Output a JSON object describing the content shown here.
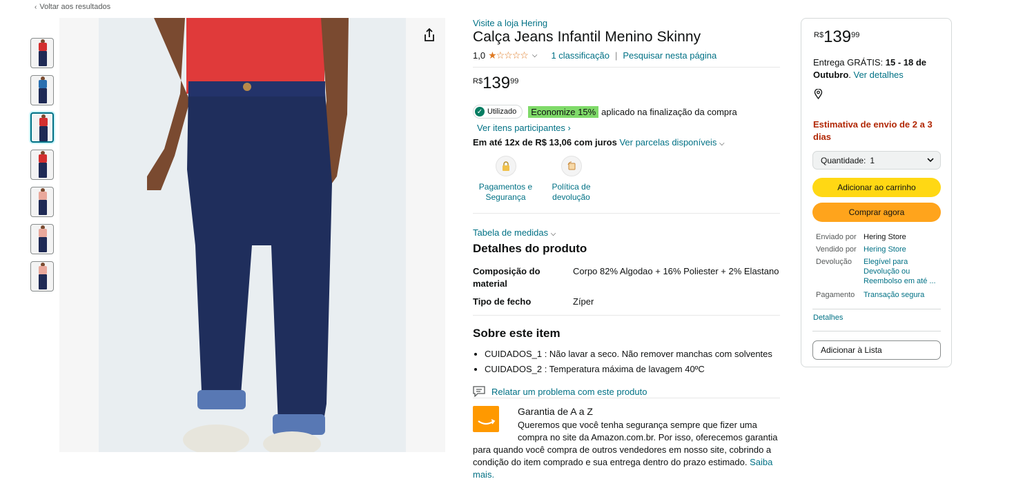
{
  "breadcrumb": {
    "back_label": "Voltar aos resultados"
  },
  "product": {
    "store_link": "Visite a loja Hering",
    "title": "Calça Jeans Infantil Menino Skinny",
    "rating_value": "1,0",
    "stars": "★☆☆☆☆",
    "rating_count": "1 classificação",
    "search_page": "Pesquisar nesta página",
    "price": {
      "currency": "R$",
      "whole": "139",
      "fraction": "99"
    },
    "promo": {
      "used_badge": "Utilizado",
      "save_label": "Economize 15%",
      "applied_text": "aplicado na finalização da compra",
      "participating_link": "Ver itens participantes ›"
    },
    "installments": {
      "bold": "Em até 12x de R$ 13,06 com juros",
      "link": "Ver parcelas disponíveis"
    },
    "features": [
      {
        "icon": "lock-icon",
        "label": "Pagamentos e Segurança"
      },
      {
        "icon": "return-icon",
        "label": "Política de devolução"
      }
    ],
    "size_table_link": "Tabela de medidas",
    "details_title": "Detalhes do produto",
    "details": [
      {
        "key": "Composição do material",
        "value": "Corpo 82% Algodao + 16% Poliester + 2% Elastano"
      },
      {
        "key": "Tipo de fecho",
        "value": "Zíper"
      }
    ],
    "about_title": "Sobre este item",
    "about_items": [
      "CUIDADOS_1 : Não lavar a seco. Não remover manchas com solventes",
      "CUIDADOS_2 : Temperatura máxima de lavagem 40ºC"
    ],
    "report_link": "Relatar um problema com este produto",
    "guarantee": {
      "title": "Garantia de A a Z",
      "text_1": "Queremos que você tenha segurança sempre que fizer uma compra no site da Amazon.com.br. Por isso, oferecemos garantia",
      "text_2": "para quando você compra de outros vendedores em nosso site, cobrindo a condição do item comprado e sua entrega dentro do prazo estimado.",
      "more_link": "Saiba mais."
    }
  },
  "gallery": {
    "thumbnails": [
      {
        "shirt": "#d32f2f",
        "selected": false
      },
      {
        "shirt": "#2a6fb0",
        "selected": false
      },
      {
        "shirt": "#d32f2f",
        "selected": true
      },
      {
        "shirt": "#d32f2f",
        "selected": false
      },
      {
        "shirt": "#e9a89b",
        "selected": false
      },
      {
        "shirt": "#e9a89b",
        "selected": false
      },
      {
        "shirt": "#e9a89b",
        "selected": false
      }
    ]
  },
  "buybox": {
    "price": {
      "currency": "R$",
      "whole": "139",
      "fraction": "99"
    },
    "delivery_prefix": "Entrega GRÁTIS: ",
    "delivery_dates": "15 - 18 de Outubro",
    "delivery_link": "Ver detalhes",
    "estimate": "Estimativa de envio de 2 a 3 dias",
    "quantity_label": "Quantidade:",
    "quantity_value": "1",
    "add_to_cart": "Adicionar ao carrinho",
    "buy_now": "Comprar agora",
    "sellers": [
      {
        "key": "Enviado por",
        "value": "Hering Store",
        "link": false
      },
      {
        "key": "Vendido por",
        "value": "Hering Store",
        "link": true
      },
      {
        "key": "Devolução",
        "value": "Elegível para Devolução ou Reembolso em até ...",
        "link": true
      },
      {
        "key": "Pagamento",
        "value": "Transação segura",
        "link": true
      }
    ],
    "details_link": "Detalhes",
    "add_to_list": "Adicionar à Lista"
  },
  "colors": {
    "link": "#007185",
    "cart_button": "#ffd814",
    "buy_button": "#ffa41c",
    "estimate_red": "#b12704",
    "promo_green": "#7fda69"
  }
}
